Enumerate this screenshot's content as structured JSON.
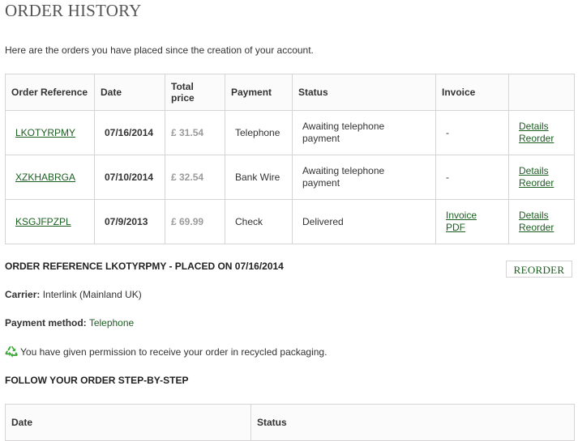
{
  "page": {
    "title": "ORDER HISTORY",
    "intro": "Here are the orders you have placed since the creation of your account."
  },
  "orders_table": {
    "headers": [
      "Order Reference",
      "Date",
      "Total price",
      "Payment",
      "Status",
      "Invoice",
      ""
    ],
    "rows": [
      {
        "reference": "LKOTYRPMY",
        "date": "07/16/2014",
        "total": "£ 31.54",
        "payment": "Telephone",
        "status": "Awaiting telephone payment",
        "invoice": "-",
        "details_label": "Details",
        "reorder_label": "Reorder"
      },
      {
        "reference": "XZKHABRGA",
        "date": "07/10/2014",
        "total": "£ 32.54",
        "payment": "Bank Wire",
        "status": "Awaiting telephone payment",
        "invoice": "-",
        "details_label": "Details",
        "reorder_label": "Reorder"
      },
      {
        "reference": "KSGJFPZPL",
        "date": "07/9/2013",
        "total": "£ 69.99",
        "payment": "Check",
        "status": "Delivered",
        "invoice": "Invoice PDF",
        "details_label": "Details",
        "reorder_label": "Reorder"
      }
    ]
  },
  "order_detail": {
    "heading": "ORDER REFERENCE LKOTYRPMY - PLACED ON 07/16/2014",
    "reorder_button": "REORDER",
    "carrier_label": "Carrier:",
    "carrier_value": "Interlink (Mainland UK)",
    "payment_label": "Payment method:",
    "payment_value": "Telephone",
    "recycle_icon": "recycle-icon",
    "recycle_text": "You have given permission to receive your order in recycled packaging.",
    "follow_heading": "FOLLOW YOUR ORDER STEP-BY-STEP"
  },
  "steps_table": {
    "headers": [
      "Date",
      "Status"
    ]
  },
  "colors": {
    "link_green": "#1b5e20",
    "border": "#d6d4d4",
    "price_grey": "#9b9b9b",
    "recycle_green": "#3aa537"
  }
}
